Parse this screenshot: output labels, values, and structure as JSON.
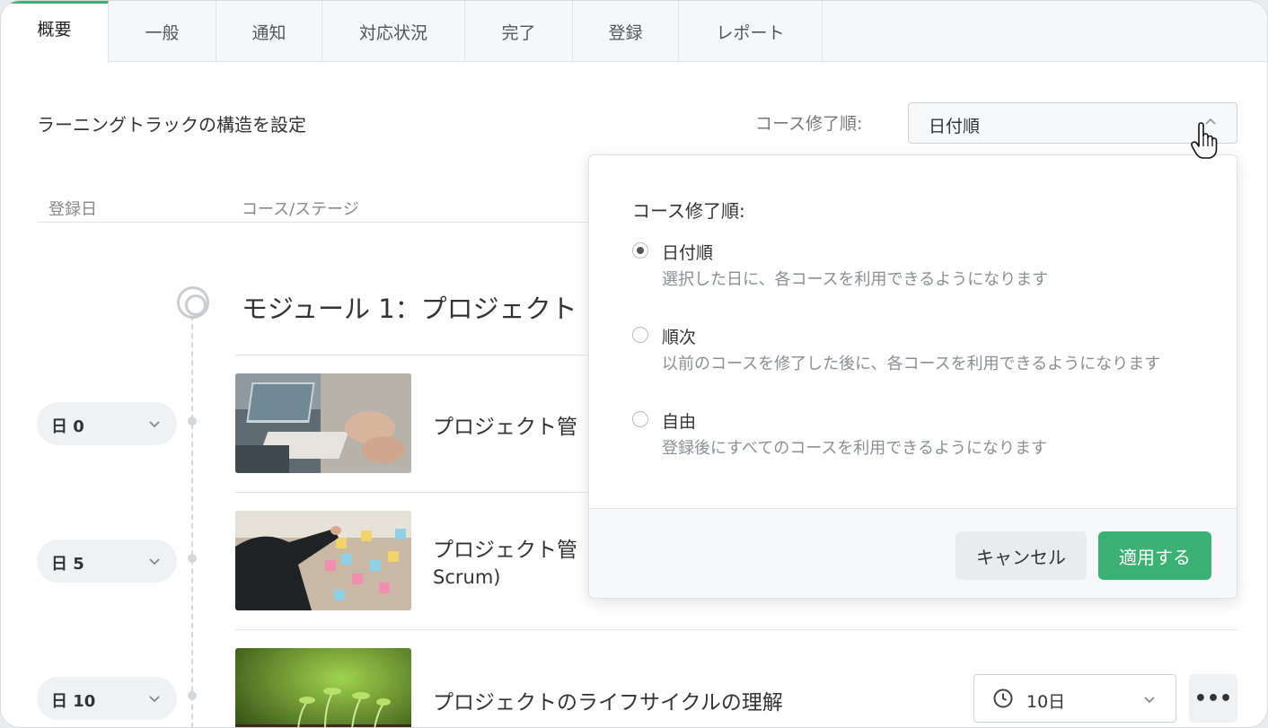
{
  "tabs": [
    {
      "label": "概要"
    },
    {
      "label": "一般"
    },
    {
      "label": "通知"
    },
    {
      "label": "対応状況"
    },
    {
      "label": "完了"
    },
    {
      "label": "登録"
    },
    {
      "label": "レポート"
    }
  ],
  "header": {
    "section_title": "ラーニングトラックの構造を設定",
    "order_label": "コース修了順:",
    "order_value": "日付順"
  },
  "columns": {
    "enroll_date": "登録日",
    "course_stage": "コース/ステージ"
  },
  "module": {
    "title": "モジュール 1：プロジェクト"
  },
  "rows": [
    {
      "day": "日 0",
      "title": "プロジェクト管",
      "subtitle": ""
    },
    {
      "day": "日 5",
      "title": "プロジェクト管",
      "subtitle": "Scrum)"
    },
    {
      "day": "日 10",
      "title": "プロジェクトのライフサイクルの理解",
      "subtitle": ""
    }
  ],
  "duration": {
    "value": "10日"
  },
  "popover": {
    "title": "コース修了順:",
    "options": [
      {
        "label": "日付順",
        "desc": "選択した日に、各コースを利用できるようになります",
        "checked": true
      },
      {
        "label": "順次",
        "desc": "以前のコースを修了した後に、各コースを利用できるようになります",
        "checked": false
      },
      {
        "label": "自由",
        "desc": "登録後にすべてのコースを利用できるようになります",
        "checked": false
      }
    ],
    "cancel_label": "キャンセル",
    "apply_label": "適用する"
  },
  "colors": {
    "accent": "#3bb273"
  },
  "icons": {
    "more": "•••"
  }
}
